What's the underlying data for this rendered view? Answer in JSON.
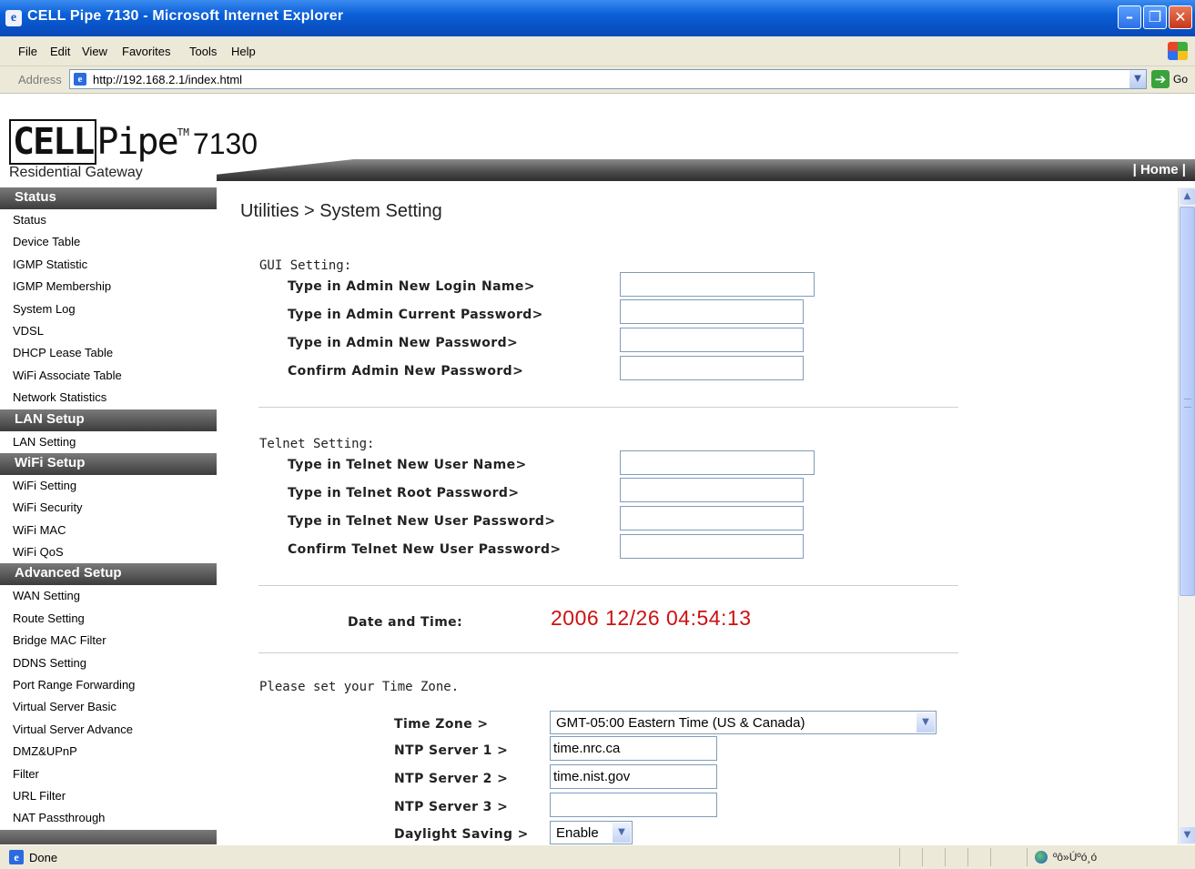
{
  "window": {
    "title": "CELL Pipe 7130 - Microsoft Internet Explorer"
  },
  "menu": {
    "items": [
      "File",
      "Edit",
      "View",
      "Favorites",
      "Tools",
      "Help"
    ]
  },
  "address": {
    "label": "Address",
    "url": "http://192.168.2.1/index.html",
    "go": "Go"
  },
  "header": {
    "brand_cell": "CELL",
    "brand_pipe": "Pipe",
    "brand_tm": "TM",
    "brand_model": "7130",
    "brand_sub": "Residential Gateway",
    "home": "| Home |"
  },
  "sidebar": {
    "sections": [
      {
        "title": "Status",
        "items": [
          "Status",
          "Device Table",
          "IGMP Statistic",
          "IGMP Membership",
          "System Log",
          "VDSL",
          "DHCP Lease Table",
          "WiFi Associate Table",
          "Network Statistics"
        ]
      },
      {
        "title": "LAN Setup",
        "items": [
          "LAN Setting"
        ]
      },
      {
        "title": "WiFi Setup",
        "items": [
          "WiFi Setting",
          "WiFi Security",
          "WiFi MAC",
          "WiFi QoS"
        ]
      },
      {
        "title": "Advanced Setup",
        "items": [
          "WAN Setting",
          "Route Setting",
          "Bridge MAC Filter",
          "DDNS Setting",
          "Port Range Forwarding",
          "Virtual Server Basic",
          "Virtual Server Advance",
          "DMZ&UPnP",
          "Filter",
          "URL Filter",
          "NAT Passthrough"
        ]
      }
    ]
  },
  "main": {
    "title": "Utilities > System Setting",
    "gui": {
      "heading": "GUI Setting:",
      "fields": [
        {
          "label": "Type in Admin New Login Name>",
          "value": ""
        },
        {
          "label": "Type in Admin Current Password>",
          "value": ""
        },
        {
          "label": "Type in Admin New Password>",
          "value": ""
        },
        {
          "label": "Confirm Admin New Password>",
          "value": ""
        }
      ]
    },
    "telnet": {
      "heading": "Telnet Setting:",
      "fields": [
        {
          "label": "Type in Telnet New User Name>",
          "value": ""
        },
        {
          "label": "Type in Telnet Root Password>",
          "value": ""
        },
        {
          "label": "Type in Telnet New User Password>",
          "value": ""
        },
        {
          "label": "Confirm Telnet New User Password>",
          "value": ""
        }
      ]
    },
    "datetime": {
      "label": "Date and Time:",
      "value": "2006 12/26 04:54:13",
      "color": "#cc1111"
    },
    "timezone": {
      "prompt": "Please set your Time Zone.",
      "zone_label": "Time Zone >",
      "zone_value": "GMT-05:00 Eastern Time (US & Canada)",
      "ntp1_label": "NTP Server 1 >",
      "ntp1_value": "time.nrc.ca",
      "ntp2_label": "NTP Server 2 >",
      "ntp2_value": "time.nist.gov",
      "ntp3_label": "NTP Server 3 >",
      "ntp3_value": "",
      "dst_label": "Daylight Saving >",
      "dst_value": "Enable"
    }
  },
  "status": {
    "text": "Done",
    "zone": "ºô»Úºó¸ó"
  }
}
